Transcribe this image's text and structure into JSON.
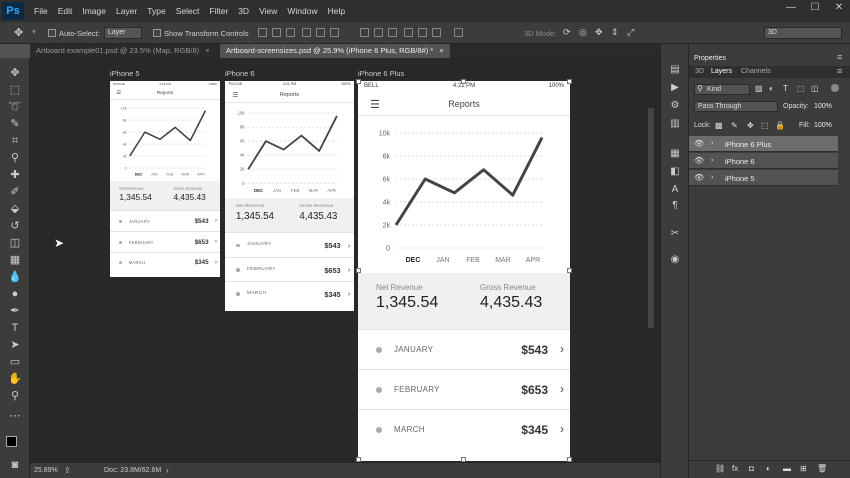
{
  "app": {
    "logo": "Ps"
  },
  "menu": [
    "File",
    "Edit",
    "Image",
    "Layer",
    "Type",
    "Select",
    "Filter",
    "3D",
    "View",
    "Window",
    "Help"
  ],
  "window_controls": {
    "minimize": "—",
    "maximize": "☐",
    "close": "✕"
  },
  "options": {
    "auto_select_label": "Auto-Select:",
    "auto_select_value": "Layer",
    "transform_label": "Show Transform Controls",
    "mode_3d_label": "3D Mode:",
    "workspace_value": "3D"
  },
  "doc_tabs": [
    {
      "label": "Artboard example01.psd @ 23.5% (Map, RGB/8)",
      "close": "×"
    },
    {
      "label": "Artboard-screensizes.psd @ 25.9% (iPhone 6 Plus, RGB/8#) *",
      "close": "×"
    }
  ],
  "status": {
    "zoom": "25.89%",
    "doc": "Doc: 23.8M/62.6M"
  },
  "panels": {
    "properties_tab": "Properties",
    "tabs": [
      "3D",
      "Layers",
      "Channels"
    ],
    "kind_label": "Kind",
    "blend_mode": "Pass Through",
    "opacity_label": "Opacity:",
    "opacity_value": "100%",
    "lock_label": "Lock:",
    "fill_label": "Fill:",
    "fill_value": "100%",
    "layers": [
      "iPhone 6 Plus",
      "iPhone 6",
      "iPhone 5"
    ]
  },
  "artboards": [
    {
      "label": "iPhone 5",
      "carrier": "PIXCUE",
      "time": "4:21 PM",
      "battery": "100%",
      "title": "Reports",
      "chart_data": {
        "type": "line",
        "categories": [
          "DEC",
          "JAN",
          "FEB",
          "MAR",
          "APR"
        ],
        "values": [
          2,
          6,
          4.8,
          6.8,
          4.6,
          9.6
        ],
        "yticks": [
          "10k",
          "8k",
          "6k",
          "4k",
          "2k",
          "0"
        ],
        "ylim": [
          0,
          10
        ]
      },
      "net_label": "Net Revenue",
      "net_value": "1,345.54",
      "gross_label": "Gross Revenue",
      "gross_value": "4,435.43",
      "months": [
        {
          "name": "JANUARY",
          "value": "$543"
        },
        {
          "name": "FEBRUARY",
          "value": "$653"
        },
        {
          "name": "MARCH",
          "value": "$345"
        }
      ]
    },
    {
      "label": "iPhone 6",
      "carrier": "PIXCUE",
      "time": "4:21 PM",
      "battery": "100%",
      "title": "Reports",
      "chart_data": {
        "type": "line",
        "categories": [
          "DEC",
          "JAN",
          "FEB",
          "MAR",
          "APR"
        ],
        "values": [
          2,
          6,
          4.8,
          6.8,
          4.6,
          9.6
        ],
        "yticks": [
          "10k",
          "8k",
          "6k",
          "4k",
          "2k",
          "0"
        ],
        "ylim": [
          0,
          10
        ]
      },
      "net_label": "Net Revenue",
      "net_value": "1,345.54",
      "gross_label": "Gross Revenue",
      "gross_value": "4,435.43",
      "months": [
        {
          "name": "JANUARY",
          "value": "$543"
        },
        {
          "name": "FEBRUARY",
          "value": "$653"
        },
        {
          "name": "MARCH",
          "value": "$345"
        }
      ]
    },
    {
      "label": "iPhone 6 Plus",
      "carrier": "BELL",
      "time": "4:21 PM",
      "battery": "100%",
      "title": "Reports",
      "chart_data": {
        "type": "line",
        "categories": [
          "DEC",
          "JAN",
          "FEB",
          "MAR",
          "APR"
        ],
        "values": [
          2,
          6,
          4.8,
          6.8,
          4.6,
          9.6
        ],
        "yticks": [
          "10k",
          "8k",
          "6k",
          "4k",
          "2k",
          "0"
        ],
        "ylim": [
          0,
          10
        ]
      },
      "net_label": "Net Revenue",
      "net_value": "1,345.54",
      "gross_label": "Gross Revenue",
      "gross_value": "4,435.43",
      "months": [
        {
          "name": "JANUARY",
          "value": "$543"
        },
        {
          "name": "FEBRUARY",
          "value": "$653"
        },
        {
          "name": "MARCH",
          "value": "$345"
        }
      ]
    }
  ]
}
